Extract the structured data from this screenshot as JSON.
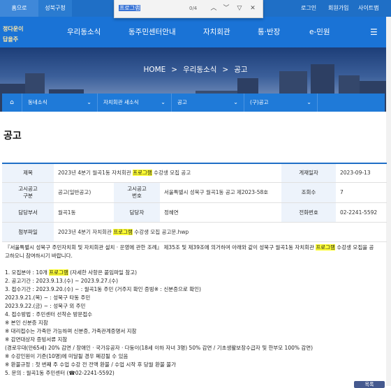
{
  "topbar": {
    "tab_home": "홈으로",
    "tab_gu": "성북구청",
    "login": "로그인",
    "signup": "회원가입",
    "sitemap": "사이트맵"
  },
  "findbar": {
    "query": "프로그램",
    "count": "0/4"
  },
  "logo": {
    "line1": "정다운이",
    "line2": "답을주"
  },
  "nav": {
    "items": [
      "우리동소식",
      "동주민센터안내",
      "자치회관",
      "통·반장",
      "e-민원"
    ]
  },
  "hero": {
    "crumbs": [
      "HOME",
      ">",
      "우리동소식",
      ">",
      "공고"
    ]
  },
  "dropdowns": {
    "items": [
      "동네소식",
      "자치회관 새소식",
      "공고",
      "(구)공고"
    ]
  },
  "page_title": "공고",
  "info": {
    "title_label": "제목",
    "title_pre": "2023년 4분기 월곡1동 자치회관 ",
    "title_hl": "프로그램",
    "title_post": " 수강생 모집 공고",
    "date_label": "게재일자",
    "date_value": "2023-09-13",
    "kind_label": "고시공고\n구분",
    "kind_value": "공고(일반공고)",
    "no_label": "고시공고\n번호",
    "no_value": "서울특별시 성북구 월곡1동 공고 제2023-58호",
    "views_label": "조회수",
    "views_value": "7",
    "dept_label": "담당부서",
    "dept_value": "월곡1동",
    "person_label": "담당자",
    "person_value": "정혜연",
    "phone_label": "전화번호",
    "phone_value": "02-2241-5592",
    "file_label": "첨부파일",
    "file_pre": "2023년 4분기 자치회관 ",
    "file_hl": "프로그램",
    "file_post": " 수강생 모집 공고문.hwp"
  },
  "body": {
    "lead_1": "『서울특별시 성북구 주민자치회 및 자치회관 설치 · 운영에 관한 조례』 제35조 및 제39조에 의거하여 아래와 같이 성북구 월곡1동 자치회관 ",
    "lead_hl": "프로그램",
    "lead_2": " 수강생 모집을 공",
    "lead_3": "고하오니 참여하시기 바랍니다.",
    "item1_pre": "1. 모집분야 : 10개 ",
    "item1_hl": "프로그램",
    "item1_post": " (자세한 사항은 붙임파일 참고)",
    "lines": [
      "2. 공고기간 : 2023.9.13.(수) ~ 2023.9.27.(수)",
      "3. 접수기간 : 2023.9.20.(수) ~ : 월곡1동 주민 (거주지 확인 증빙※ : 신분증으로 확인)",
      "2023.9.21.(목) ~ : 성북구 타동 주민",
      "2023.9.22.(금) ~ : 성북구 외 주민",
      "4. 접수방법 : 주민센터 선착순 방문접수",
      "※ 본인 신분증 지참",
      "※ 대리접수는 가족만 가능하며 신분증, 가족관계증명서 지참",
      "※ 감면대상자 증빙서류 지참",
      "(경로우대(만65세) 20% 감면 / 장애인 · 국가유공자 · 다둥이(18세 이하 자녀 3명) 50% 감면 / 기초생활보장수급자 및 한부모 100% 감면)",
      "※ 수강인원이 기준(10명)에 미달될 경우 폐강될 수 있음",
      "※ 환불규정 : 첫 번째 주 수업 수강 전 전액 환불 / 수업 시작 후 당월 환불 불가",
      "5. 문의 : 월곡1동 주민센터 (☎02-2241-5592)"
    ]
  },
  "list_button": "목록"
}
